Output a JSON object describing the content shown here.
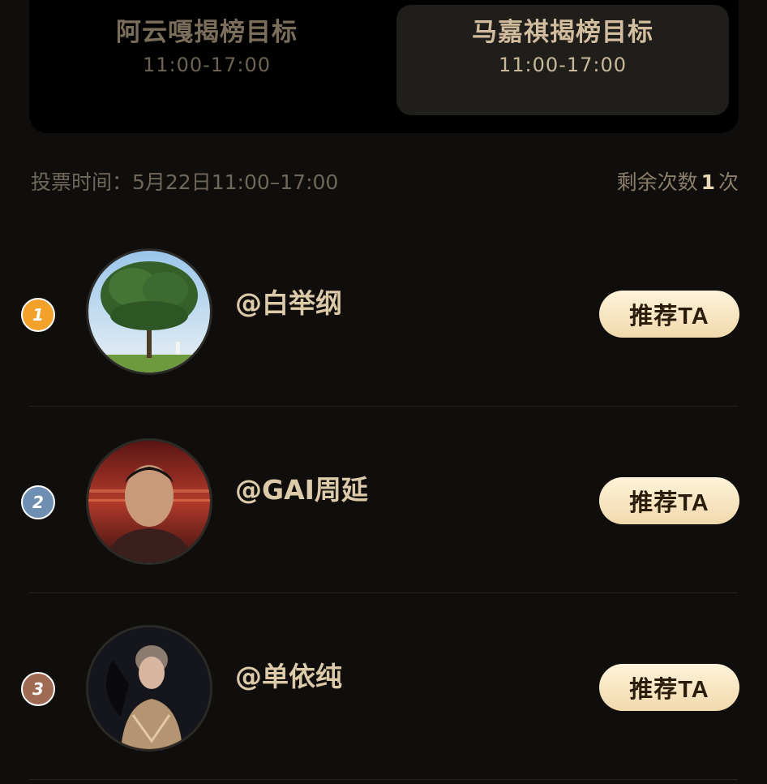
{
  "tabs": [
    {
      "title": "阿云嘎揭榜目标",
      "time": "11:00-17:00",
      "active": false
    },
    {
      "title": "马嘉祺揭榜目标",
      "time": "11:00-17:00",
      "active": true
    }
  ],
  "vote_time": "投票时间：5月22日11:00–17:00",
  "remaining": {
    "prefix": "剩余次数",
    "count": "1",
    "suffix": "次"
  },
  "candidates": [
    {
      "rank": "1",
      "name": "@白举纲",
      "button": "推荐TA",
      "rank_color": "#f2a12a"
    },
    {
      "rank": "2",
      "name": "@GAI周延",
      "button": "推荐TA",
      "rank_color": "#6e8fb2"
    },
    {
      "rank": "3",
      "name": "@单依纯",
      "button": "推荐TA",
      "rank_color": "#a06a55"
    }
  ]
}
